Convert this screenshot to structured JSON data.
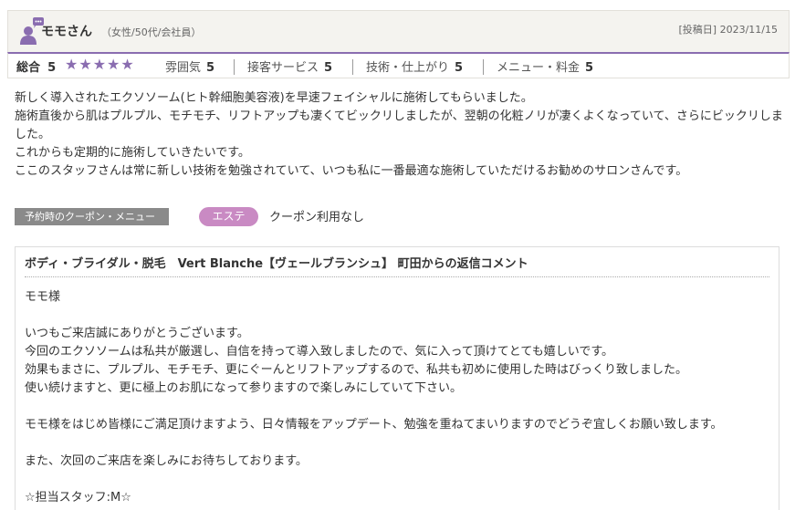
{
  "reviewer": {
    "name": "モモさん",
    "meta": "（女性/50代/会社員）",
    "date": "[投稿日] 2023/11/15"
  },
  "ratings": {
    "overall_label": "総合",
    "overall_value": "5",
    "stars": "★★★★★",
    "items": [
      {
        "label": "雰囲気",
        "value": "5"
      },
      {
        "label": "接客サービス",
        "value": "5"
      },
      {
        "label": "技術・仕上がり",
        "value": "5"
      },
      {
        "label": "メニュー・料金",
        "value": "5"
      }
    ]
  },
  "review": {
    "lines": [
      "新しく導入されたエクソソーム(ヒト幹細胞美容液)を早速フェイシャルに施術してもらいました。",
      "施術直後から肌はプルプル、モチモチ、リフトアップも凄くてビックリしましたが、翌朝の化粧ノリが凄くよくなっていて、さらにビックリしました。",
      "これからも定期的に施術していきたいです。",
      "ここのスタッフさんは常に新しい技術を勉強されていて、いつも私に一番最適な施術していただけるお勧めのサロンさんです。"
    ]
  },
  "coupon": {
    "label": "予約時のクーポン・メニュー",
    "tag": "エステ",
    "status": "クーポン利用なし"
  },
  "reply": {
    "title": "ボディ・ブライダル・脱毛　Vert Blanche【ヴェールブランシュ】 町田からの返信コメント",
    "lines": [
      "モモ様",
      "",
      "いつもご来店誠にありがとうございます。",
      "今回のエクソソームは私共が厳選し、自信を持って導入致しましたので、気に入って頂けてとても嬉しいです。",
      "効果もまさに、プルプル、モチモチ、更にぐーんとリフトアップするので、私共も初めに使用した時はびっくり致しました。",
      "使い続けますと、更に極上のお肌になって参りますので楽しみにしていて下さい。",
      "",
      "モモ様をはじめ皆様にご満足頂けますよう、日々情報をアップデート、勉強を重ねてまいりますのでどうぞ宜しくお願い致します。",
      "",
      "また、次回のご来店を楽しみにお待ちしております。",
      "",
      "☆担当スタッフ:M☆"
    ]
  },
  "colors": {
    "accent": "#8a6db0",
    "tag": "#c98ac3",
    "label_bg": "#8a8a8a"
  }
}
